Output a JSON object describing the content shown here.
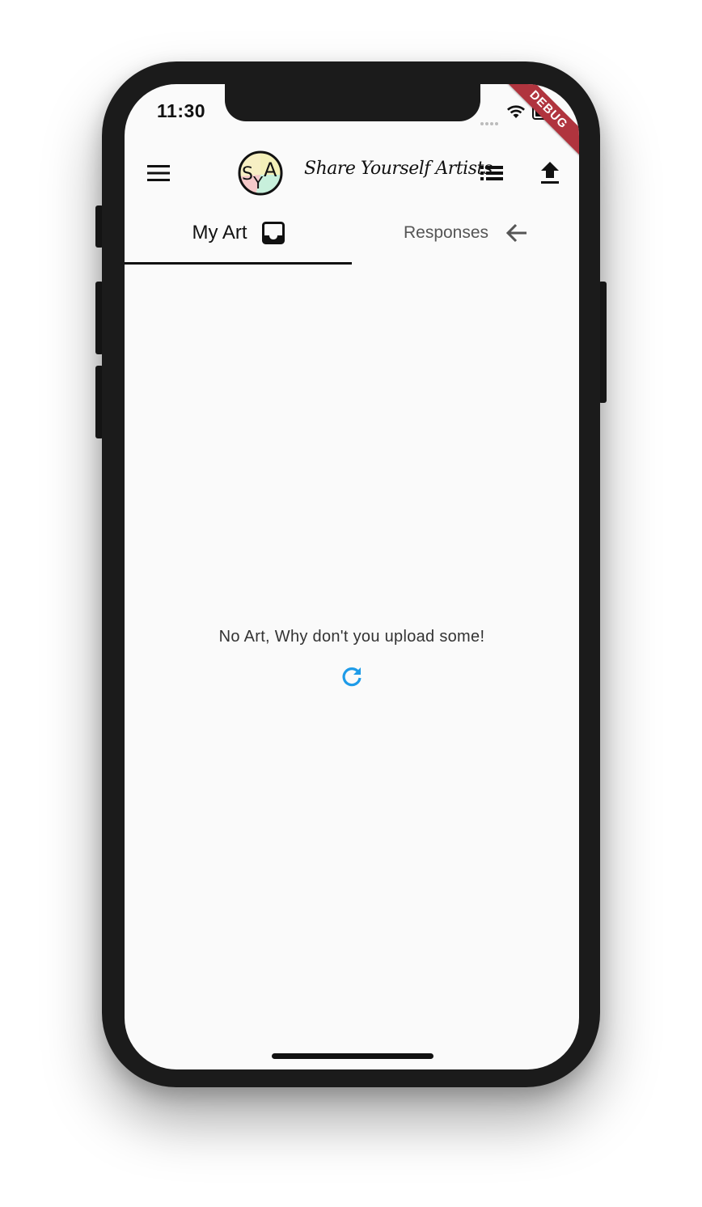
{
  "status_bar": {
    "time": "11:30"
  },
  "debug_banner": "DEBUG",
  "app_bar": {
    "title": "Share Yourself Artists",
    "logo_text": "SYA",
    "menu_icon": "hamburger-menu-icon",
    "list_icon": "list-icon",
    "upload_icon": "upload-icon"
  },
  "tabs": [
    {
      "label": "My Art",
      "icon": "inbox-icon",
      "selected": true
    },
    {
      "label": "Responses",
      "icon": "arrow-back-icon",
      "selected": false
    }
  ],
  "main": {
    "empty_message": "No Art, Why don't you upload some!",
    "refresh_icon": "refresh-icon"
  },
  "colors": {
    "accent": "#1e9be8",
    "debug_banner": "#b0343e",
    "background": "#fafafa",
    "frame": "#1b1b1b"
  }
}
